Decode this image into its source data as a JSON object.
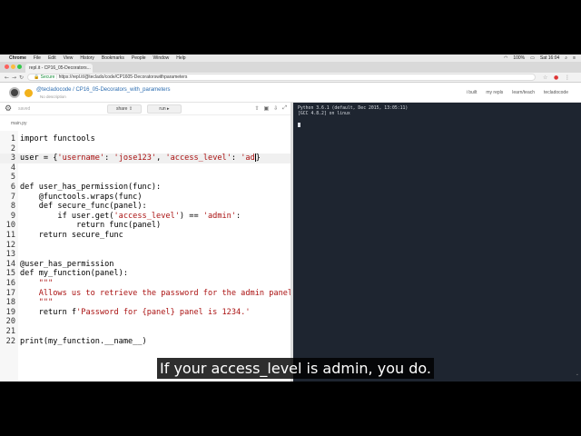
{
  "mac_menu": {
    "app": "Chrome",
    "items": [
      "File",
      "Edit",
      "View",
      "History",
      "Bookmarks",
      "People",
      "Window",
      "Help"
    ],
    "battery": "100%",
    "clock": "Sat 16:04"
  },
  "browser": {
    "tab_title": "repl.it - CP16_05-Decorators...",
    "secure_label": "Secure",
    "url": "https://repl.it/@teclado/code/CP1605-Decoratorswithparameters"
  },
  "repl": {
    "title": "@tecladocode / CP16_05-Decorators_with_parameters",
    "description": "No description",
    "header_links": [
      "i built",
      "my repls",
      "learn/teach",
      "tecladocode"
    ],
    "saved_status": "saved",
    "share_label": "share",
    "run_label": "run",
    "file_name": "main.py"
  },
  "code_lines": [
    {
      "n": "1",
      "text": "import functools"
    },
    {
      "n": "2",
      "text": ""
    },
    {
      "n": "3",
      "pre": "user = {",
      "s1": "'username'",
      "m1": ": ",
      "s2": "'jose123'",
      "m2": ", ",
      "s3": "'access_level'",
      "m3": ": ",
      "s4": "'ad",
      "post": "}"
    },
    {
      "n": "4",
      "text": ""
    },
    {
      "n": "5",
      "text": ""
    },
    {
      "n": "6",
      "text": "def user_has_permission(func):"
    },
    {
      "n": "7",
      "text": "    @functools.wraps(func)"
    },
    {
      "n": "8",
      "text": "    def secure_func(panel):"
    },
    {
      "n": "9",
      "pre": "        if user.get(",
      "s1": "'access_level'",
      "m1": ") == ",
      "s2": "'admin'",
      "post": ":"
    },
    {
      "n": "10",
      "text": "            return func(panel)"
    },
    {
      "n": "11",
      "text": "    return secure_func"
    },
    {
      "n": "12",
      "text": ""
    },
    {
      "n": "13",
      "text": ""
    },
    {
      "n": "14",
      "text": "@user_has_permission"
    },
    {
      "n": "15",
      "text": "def my_function(panel):"
    },
    {
      "n": "16",
      "strline": "    \"\"\""
    },
    {
      "n": "17",
      "strline": "    Allows us to retrieve the password for the admin panel."
    },
    {
      "n": "18",
      "strline": "    \"\"\""
    },
    {
      "n": "19",
      "pre": "    return f",
      "s1": "'Password for {panel} panel is 1234.'",
      "post": ""
    },
    {
      "n": "20",
      "text": ""
    },
    {
      "n": "21",
      "text": ""
    },
    {
      "n": "22",
      "text": "print(my_function.__name__)"
    }
  ],
  "console": {
    "line1": "Python 3.6.1 (default, Dec 2015, 13:05:11)",
    "line2": "[GCC 4.8.2] on linux"
  },
  "subtitle": "If your access_level is admin, you do.",
  "colors": {
    "string": "#aa1111",
    "console_bg": "#1e2530",
    "link": "#2b6cb0"
  }
}
